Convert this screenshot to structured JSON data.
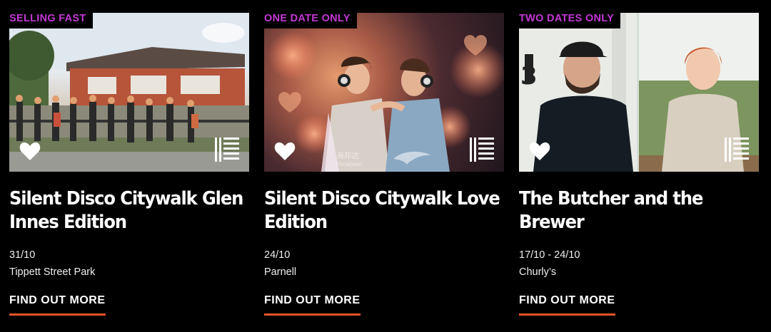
{
  "cards": [
    {
      "badge": "SELLING FAST",
      "title": "Silent Disco Citywalk Glen Innes Edition",
      "date": "31/10",
      "venue": "Tippett Street Park",
      "cta": "FIND OUT MORE"
    },
    {
      "badge": "ONE DATE ONLY",
      "title": "Silent Disco Citywalk Love Edition",
      "date": "24/10",
      "venue": "Parnell",
      "cta": "FIND OUT MORE",
      "watermark": "海邦达 Hinabian"
    },
    {
      "badge": "TWO DATES ONLY",
      "title": "The Butcher and the Brewer",
      "date": "17/10 - 24/10",
      "venue": "Churly’s",
      "cta": "FIND OUT MORE"
    }
  ],
  "colors": {
    "badge": "#c438d6",
    "accent": "#e8542a",
    "background": "#000000"
  },
  "icons": [
    "heart-icon",
    "brand-grid-icon"
  ]
}
